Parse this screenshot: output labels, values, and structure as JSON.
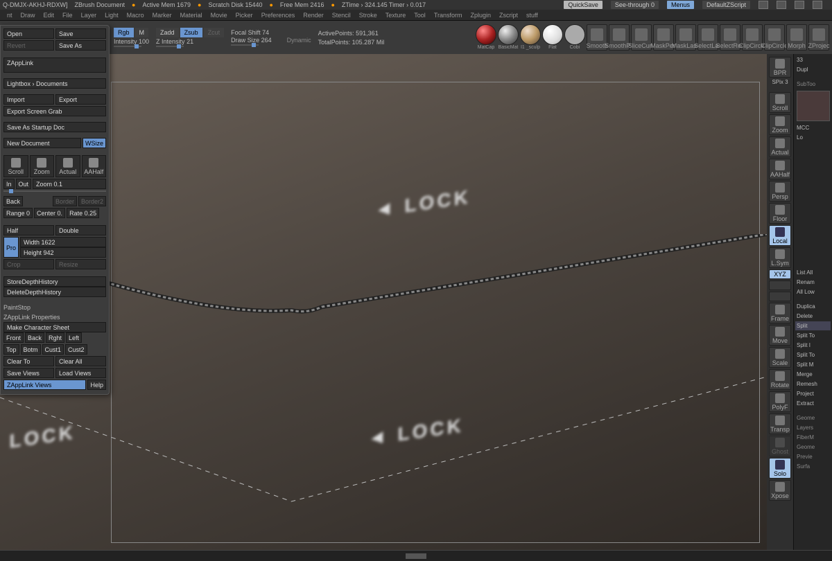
{
  "title": {
    "project": "Q-DMJX-AKHJ-RDXW]",
    "doc": "ZBrush Document",
    "mem": "Active Mem 1679",
    "scratch": "Scratch Disk 15440",
    "free": "Free Mem 2416",
    "ztime": "ZTime › 324.145 Timer › 0.017",
    "quicksave": "QuickSave",
    "seethrough": "See-through  0",
    "menus": "Menus",
    "zscript": "DefaultZScript"
  },
  "menu": [
    "nt",
    "Draw",
    "Edit",
    "File",
    "Layer",
    "Light",
    "Macro",
    "Marker",
    "Material",
    "Movie",
    "Picker",
    "Preferences",
    "Render",
    "Stencil",
    "Stroke",
    "Texture",
    "Tool",
    "Transform",
    "Zplugin",
    "Zscript",
    "stuff"
  ],
  "toolstrip": {
    "rgb": "Rgb",
    "m": "M",
    "zadd": "Zadd",
    "zsub": "Zsub",
    "zcut": "Zcut",
    "intensity": "Intensity 100",
    "zintensity": "Z Intensity 21",
    "focal": "Focal Shift 74",
    "drawsize": "Draw Size 264",
    "dynamic": "Dynamic",
    "active": "ActivePoints: 591,361",
    "total": "TotalPoints: 105.287 Mil",
    "mats": [
      "MatCap",
      "BasicMat",
      "I1 _sculp",
      "Flat",
      "Cobi",
      "Smooth",
      "SmoothPk",
      "SliceCurv",
      "MaskPen",
      "MaskLass",
      "SelectLas",
      "SelectRec",
      "ClipCircle",
      "ClipCircle",
      "Morph",
      "ZProjec"
    ]
  },
  "left_panel": {
    "open": "Open",
    "save": "Save",
    "revert": "Revert",
    "saveas": "Save As",
    "zapplink": "ZAppLink",
    "lightbox": "Lightbox › Documents",
    "import": "Import",
    "export": "Export",
    "grab": "Export Screen Grab",
    "startup": "Save As Startup Doc",
    "newdoc": "New Document",
    "wsize": "WSize",
    "navicons": [
      "Scroll",
      "Zoom",
      "Actual",
      "AAHalf"
    ],
    "in": "In",
    "out": "Out",
    "zoom": "Zoom 0.1",
    "back": "Back",
    "border": "Border",
    "border2": "Border2",
    "range": "Range 0",
    "center": "Center 0.",
    "rate": "Rate 0.25",
    "half": "Half",
    "double": "Double",
    "pro": "Pro",
    "width": "Width 1622",
    "height": "Height 942",
    "crop": "Crop",
    "resize": "Resize",
    "store": "StoreDepthHistory",
    "delete": "DeleteDepthHistory",
    "paintstop": "PaintStop",
    "zprops": "ZAppLink Properties",
    "makechar": "Make Character Sheet",
    "views": [
      "Front",
      "Back",
      "Rght",
      "Left",
      "Top",
      "Botm",
      "Cust1",
      "Cust2"
    ],
    "clearto": "Clear To",
    "clearall": "Clear All",
    "saveviews": "Save Views",
    "loadviews": "Load Views",
    "zapplinkviews": "ZAppLink Views",
    "help": "Help"
  },
  "right_rail": [
    "BPR",
    "SPix 3",
    "Scroll",
    "Zoom",
    "Actual",
    "AAHalf",
    "Persp",
    "Floor",
    "Local",
    "L.Sym",
    "XYZ",
    "",
    "",
    "Frame",
    "Move",
    "Scale",
    "Rotate",
    "PolyF",
    "Transp",
    "Ghost",
    "Solo",
    "Xpose"
  ],
  "far_right": {
    "top_num": "33",
    "dup": "Dupl",
    "subtoo": "SubToo",
    "mcc": "MCC",
    "lo": "Lo",
    "listall": "List All",
    "rename": "Renam",
    "alllow": "All Low",
    "duplicate": "Duplica",
    "delete": "Delete",
    "split": "Split",
    "splits": [
      "Split To",
      "Split I",
      "Split To",
      "Split M"
    ],
    "merge": "Merge",
    "remesh": "Remesh",
    "project": "Project",
    "extract": "Extract",
    "bottom": [
      "Geome",
      "Layers",
      "FiberM",
      "Geome",
      "Previe",
      "Surfa"
    ]
  },
  "canvas": {
    "lock": "◄ LOCK"
  }
}
